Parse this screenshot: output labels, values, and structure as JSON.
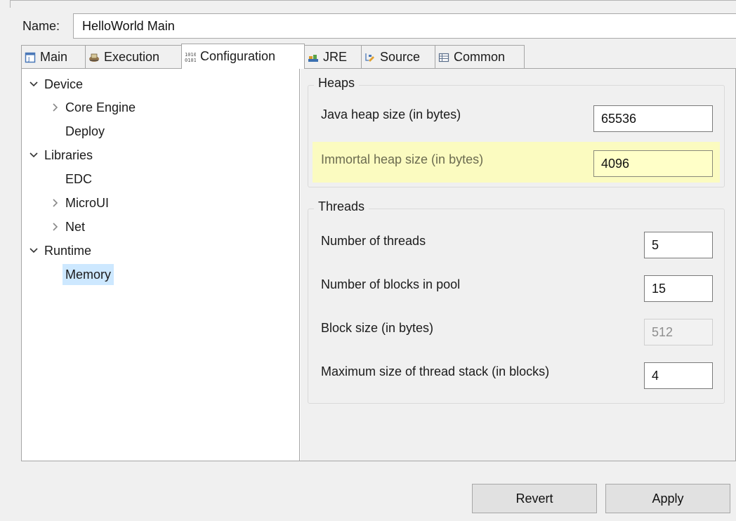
{
  "form": {
    "name_label": "Name:",
    "name_value": "HelloWorld Main"
  },
  "tabs": [
    {
      "label": "Main",
      "icon": "main-tab-icon"
    },
    {
      "label": "Execution",
      "icon": "execution-icon"
    },
    {
      "label": "Configuration",
      "icon": "configuration-icon",
      "active": true
    },
    {
      "label": "JRE",
      "icon": "jre-icon"
    },
    {
      "label": "Source",
      "icon": "source-icon"
    },
    {
      "label": "Common",
      "icon": "common-icon"
    }
  ],
  "tree": {
    "device": "Device",
    "core_engine": "Core Engine",
    "deploy": "Deploy",
    "libraries": "Libraries",
    "edc": "EDC",
    "microui": "MicroUI",
    "net": "Net",
    "runtime": "Runtime",
    "memory": "Memory",
    "selected": "Memory"
  },
  "heaps": {
    "title": "Heaps",
    "java_heap_label": "Java heap size (in bytes)",
    "java_heap_value": "65536",
    "immortal_heap_label": "Immortal heap size (in bytes)",
    "immortal_heap_value": "4096"
  },
  "threads": {
    "title": "Threads",
    "num_threads_label": "Number of threads",
    "num_threads_value": "5",
    "blocks_pool_label": "Number of blocks in pool",
    "blocks_pool_value": "15",
    "block_size_label": "Block size (in bytes)",
    "block_size_value": "512",
    "max_stack_label": "Maximum size of thread stack (in blocks)",
    "max_stack_value": "4"
  },
  "buttons": {
    "revert": "Revert",
    "apply": "Apply"
  },
  "colors": {
    "highlight": "#fbfbc0",
    "selection": "#cde8ff"
  }
}
